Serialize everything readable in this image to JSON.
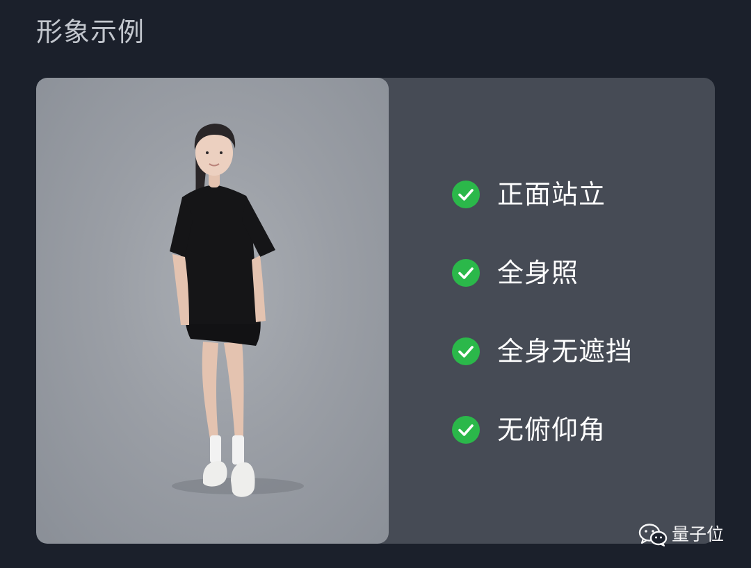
{
  "section": {
    "title": "形象示例"
  },
  "example_photo": {
    "subject": "full-body-standing-person"
  },
  "requirements": [
    {
      "label": "正面站立",
      "icon": "check-circle-icon"
    },
    {
      "label": "全身照",
      "icon": "check-circle-icon"
    },
    {
      "label": "全身无遮挡",
      "icon": "check-circle-icon"
    },
    {
      "label": "无俯仰角",
      "icon": "check-circle-icon"
    }
  ],
  "watermark": {
    "text": "量子位",
    "icon": "wechat-icon"
  },
  "colors": {
    "background": "#1b202b",
    "card": "#464b55",
    "check": "#2bb84a",
    "title_text": "#c3c7ce",
    "label_text": "#ffffff"
  }
}
